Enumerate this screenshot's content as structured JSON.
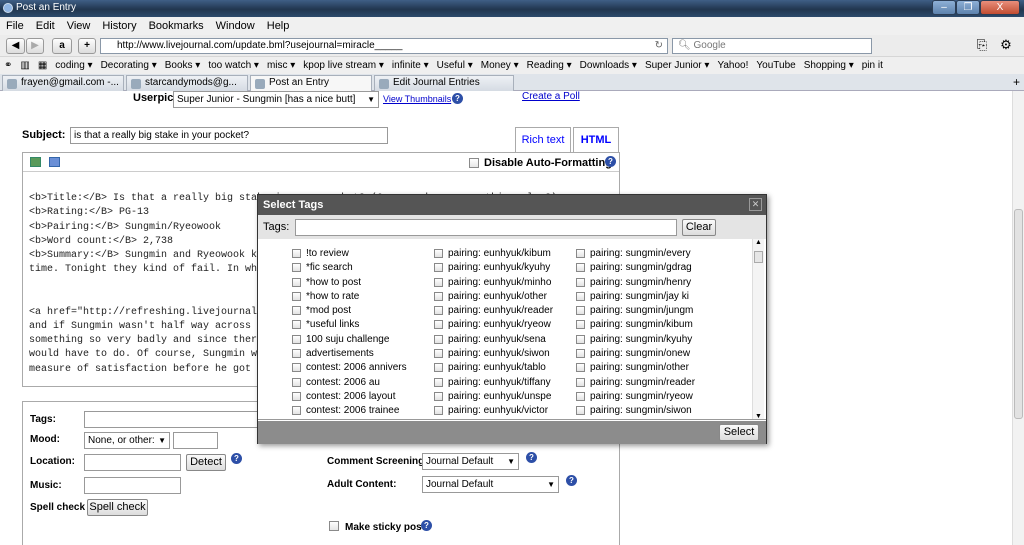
{
  "window": {
    "title": "Post an Entry",
    "controls": [
      "–",
      "❐",
      "X"
    ]
  },
  "menu": [
    "File",
    "Edit",
    "View",
    "History",
    "Bookmarks",
    "Window",
    "Help"
  ],
  "nav": {
    "url": "http://www.livejournal.com/update.bml?usejournal=miracle_____",
    "search_placeholder": "Google"
  },
  "bookmarks": [
    "coding ▾",
    "Decorating ▾",
    "Books ▾",
    "too watch ▾",
    "misc ▾",
    "kpop live stream ▾",
    "infinite ▾",
    "Useful ▾",
    "Money ▾",
    "Reading ▾",
    "Downloads ▾",
    "Super Junior ▾",
    "Yahoo!",
    "YouTube",
    "Shopping ▾",
    "pin it"
  ],
  "tabs": [
    "frayen@gmail.com -...",
    "starcandymods@g...",
    "Post an Entry",
    "Edit Journal Entries"
  ],
  "userpic": {
    "label": "Userpic:",
    "value": "Super Junior - Sungmin [has a nice butt]",
    "view_link": "View Thumbnails",
    "poll_link": "Create a Poll"
  },
  "subject": {
    "label": "Subject:",
    "value": "is that a really big stake in your pocket?"
  },
  "editor": {
    "rich_tab": "Rich text",
    "html_tab": "HTML",
    "disable_label": "Disable Auto-Formatting",
    "lines": [
      "<b>Title:</B> Is that a really big stake in your pocket? (Or, you know, something else?)",
      "<b>Rating:</B> PG-13",
      "<b>Pairing:</B> Sungmin/Ryeowook",
      "<b>Word count:</B> 2,738",
      "<b>Summary:</B> Sungmin and Ryeowook k",
      "time. Tonight they kind of fail. In wh",
      "",
      "",
      "<a href=\"http://refreshing.livejournal",
      "and if Sungmin wasn't half way across",
      "something so very badly and since ther",
      "would have to do. Of course, Sungmin w",
      "measure of satisfaction before he got"
    ]
  },
  "form": {
    "tags_label": "Tags:",
    "mood_label": "Mood:",
    "mood_value": "None, or other:",
    "location_label": "Location:",
    "detect_button": "Detect",
    "music_label": "Music:",
    "spell_label": "Spell check",
    "spell_button": "Spell check",
    "screening_label": "Comment Screening:",
    "screening_value": "Journal Default",
    "adult_label": "Adult Content:",
    "adult_value": "Journal Default",
    "sticky_label": "Make sticky post"
  },
  "dialog": {
    "title": "Select Tags",
    "tags_label": "Tags:",
    "clear_button": "Clear",
    "select_button": "Select",
    "col1": [
      "!to review",
      "*fic search",
      "*how to post",
      "*how to rate",
      "*mod post",
      "*useful links",
      "100 suju challenge",
      "advertisements",
      "contest: 2006 annivers",
      "contest: 2006 au",
      "contest: 2006 layout",
      "contest: 2006 trainee"
    ],
    "col2": [
      "pairing: eunhyuk/kibum",
      "pairing: eunhyuk/kyuhy",
      "pairing: eunhyuk/minho",
      "pairing: eunhyuk/other",
      "pairing: eunhyuk/reader",
      "pairing: eunhyuk/ryeow",
      "pairing: eunhyuk/sena",
      "pairing: eunhyuk/siwon",
      "pairing: eunhyuk/tablo",
      "pairing: eunhyuk/tiffany",
      "pairing: eunhyuk/unspe",
      "pairing: eunhyuk/victor"
    ],
    "col3": [
      "pairing: sungmin/every",
      "pairing: sungmin/gdrag",
      "pairing: sungmin/henry",
      "pairing: sungmin/jay ki",
      "pairing: sungmin/jungm",
      "pairing: sungmin/kibum",
      "pairing: sungmin/kyuhy",
      "pairing: sungmin/onew",
      "pairing: sungmin/other",
      "pairing: sungmin/reader",
      "pairing: sungmin/ryeow",
      "pairing: sungmin/siwon"
    ]
  }
}
